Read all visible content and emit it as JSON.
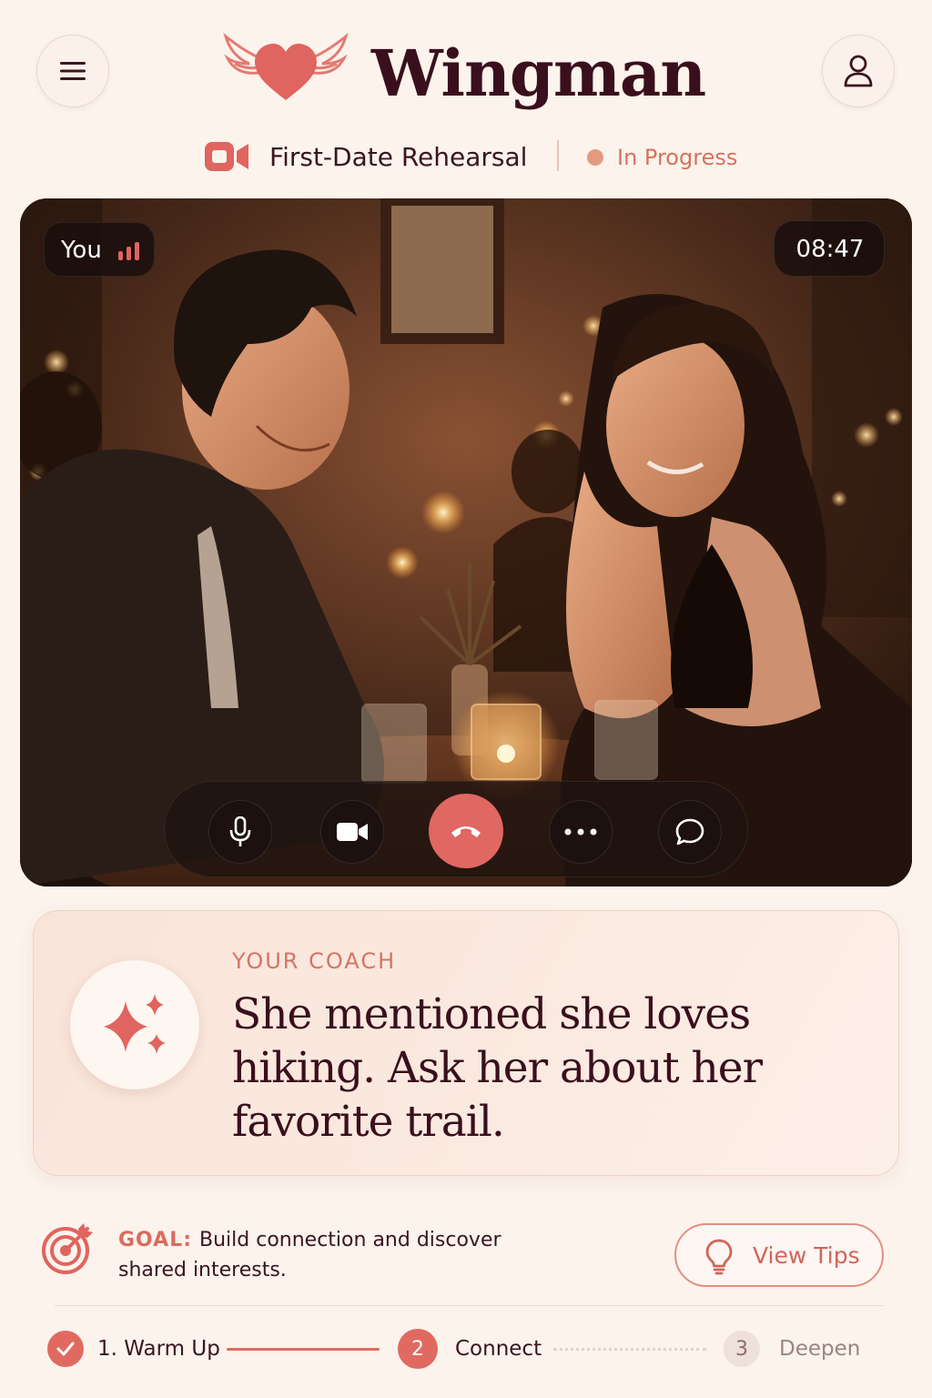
{
  "header": {
    "app_title": "Wingman",
    "session_title": "First-Date Rehearsal",
    "status": "In Progress"
  },
  "video": {
    "self_label": "You",
    "timer": "08:47",
    "controls": [
      "microphone",
      "camera",
      "end-call",
      "more",
      "chat"
    ]
  },
  "coach": {
    "label": "YOUR COACH",
    "message": "She mentioned she loves hiking. Ask her about her favorite trail."
  },
  "goal": {
    "label": "GOAL:",
    "text": "Build connection and discover shared interests.",
    "tips_button": "View Tips"
  },
  "steps": [
    {
      "label": "1. Warm Up",
      "state": "done"
    },
    {
      "number": "2",
      "label": "Connect",
      "state": "active"
    },
    {
      "number": "3",
      "label": "Deepen",
      "state": "upcoming"
    }
  ],
  "colors": {
    "accent": "#e06a60",
    "background": "#fbf3ec",
    "title": "#3a0f1d"
  }
}
